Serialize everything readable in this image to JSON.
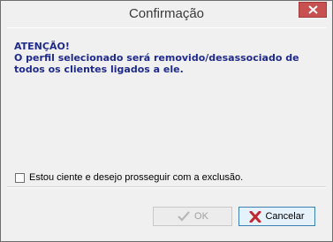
{
  "window": {
    "title": "Confirmação"
  },
  "message": {
    "line1": "ATENÇÃO!",
    "line2": "O perfil selecionado será removido/desassociado de",
    "line3": "todos os clientes ligados a ele."
  },
  "confirm_checkbox": {
    "label": "Estou ciente e desejo prosseguir com a exclusão.",
    "checked": false
  },
  "buttons": {
    "ok_label": "OK",
    "ok_icon": "checkmark-icon",
    "ok_enabled": false,
    "cancel_label": "Cancelar",
    "cancel_icon": "x-icon"
  },
  "colors": {
    "warning_text": "#1f2a8a",
    "close_button": "#c75050",
    "cancel_icon": "#c0282d"
  }
}
